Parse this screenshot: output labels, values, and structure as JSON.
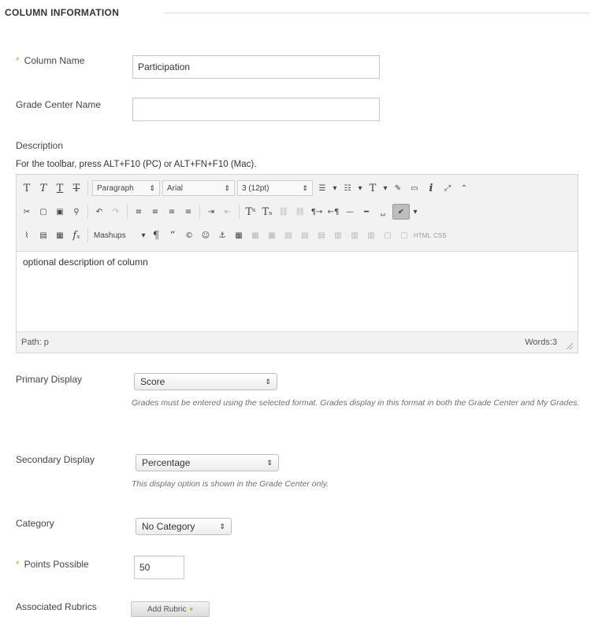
{
  "section": {
    "title": "COLUMN INFORMATION"
  },
  "column_name": {
    "label": "Column Name",
    "value": "Participation",
    "required_marker": "*"
  },
  "grade_center_name": {
    "label": "Grade Center Name",
    "value": ""
  },
  "description": {
    "label": "Description",
    "toolbar_hint": "For the toolbar, press ALT+F10 (PC) or ALT+FN+F10 (Mac).",
    "toolbar": {
      "format_select": "Paragraph",
      "font_select": "Arial",
      "size_select": "3 (12pt)",
      "mashups_label": "Mashups",
      "html_label": "HTML",
      "css_label": "CSS"
    },
    "content": "optional description of column",
    "path": "Path: p",
    "words": "Words:3"
  },
  "primary_display": {
    "label": "Primary Display",
    "selected": "Score",
    "help": "Grades must be entered using the selected format. Grades display in this format in both the Grade Center and My Grades."
  },
  "secondary_display": {
    "label": "Secondary Display",
    "selected": "Percentage",
    "help": "This display option is shown in the Grade Center only."
  },
  "category": {
    "label": "Category",
    "selected": "No Category"
  },
  "points_possible": {
    "label": "Points Possible",
    "value": "50",
    "required_marker": "*"
  },
  "associated_rubrics": {
    "label": "Associated Rubrics",
    "button_label": "Add Rubric"
  },
  "colors": {
    "required": "#d9a441",
    "toolbar_bg": "#f2f2f2",
    "help_text": "#6f6f6f"
  }
}
